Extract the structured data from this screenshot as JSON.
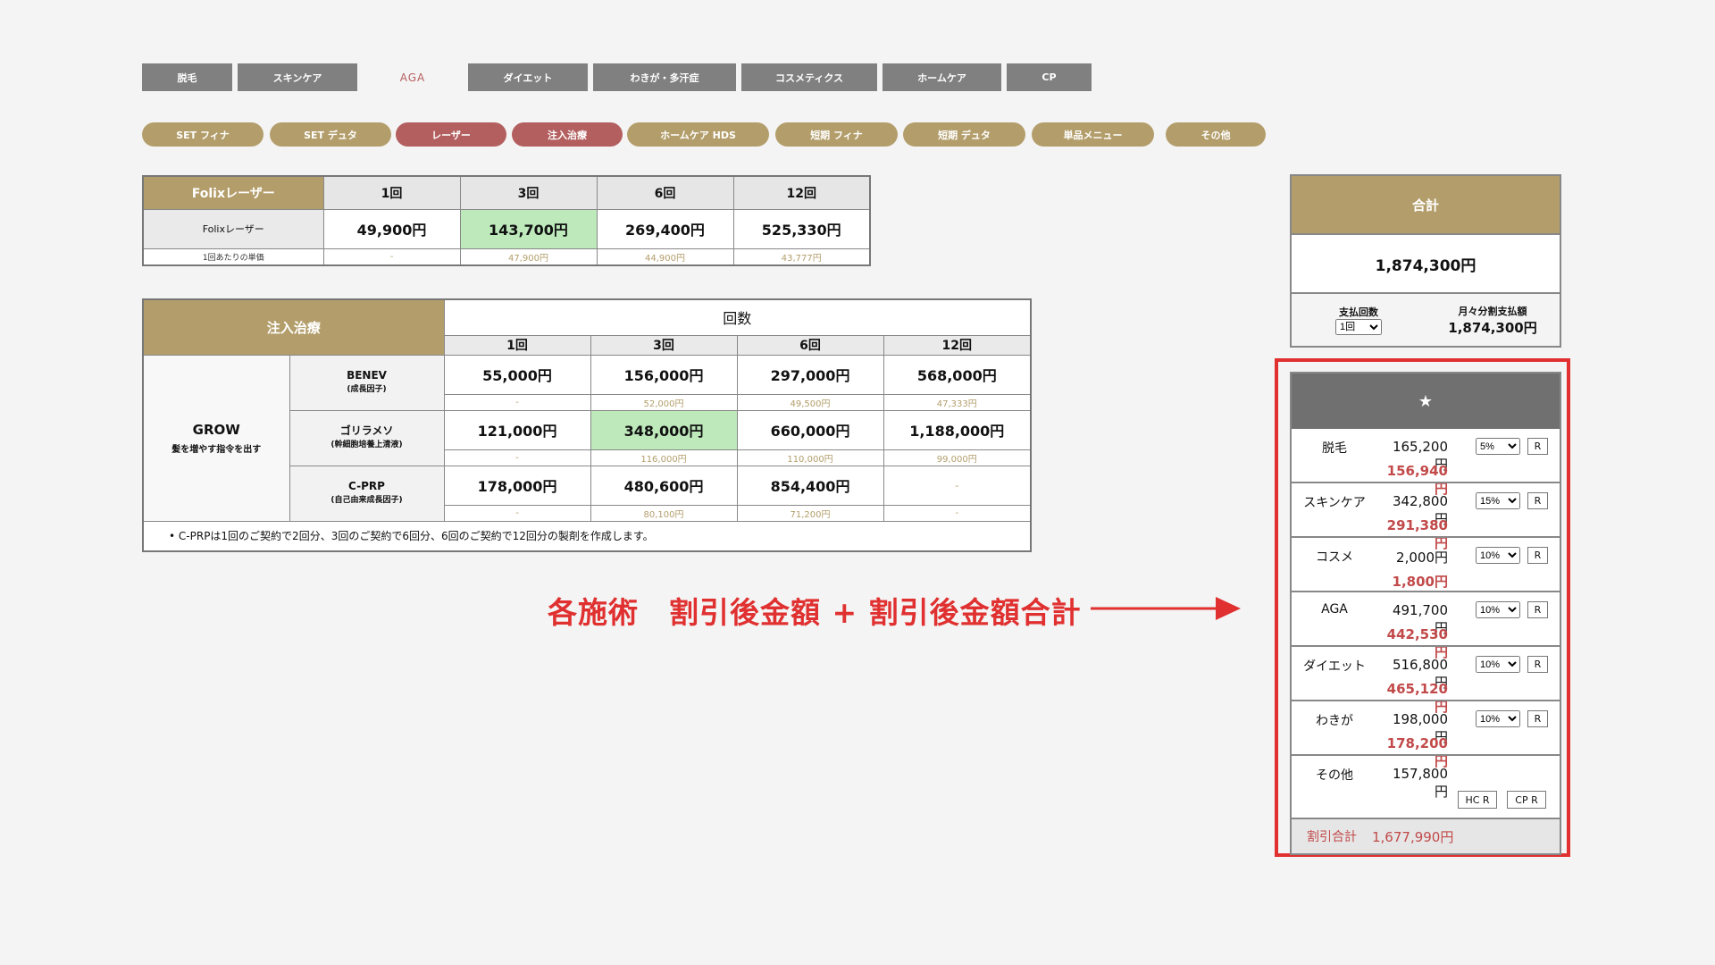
{
  "nav": {
    "tabs": [
      {
        "label": "脱毛",
        "active": false
      },
      {
        "label": "スキンケア",
        "active": false
      },
      {
        "label": "AGA",
        "active": true
      },
      {
        "label": "ダイエット",
        "active": false
      },
      {
        "label": "わきが・多汗症",
        "active": false
      },
      {
        "label": "コスメティクス",
        "active": false
      },
      {
        "label": "ホームケア",
        "active": false
      },
      {
        "label": "CP",
        "active": false
      }
    ],
    "subtabs": [
      {
        "label": "SET フィナ",
        "style": "gold"
      },
      {
        "label": "SET デュタ",
        "style": "gold"
      },
      {
        "label": "レーザー",
        "style": "red"
      },
      {
        "label": "注入治療",
        "style": "red"
      },
      {
        "label": "ホームケア HDS",
        "style": "gold"
      },
      {
        "label": "短期 フィナ",
        "style": "gold"
      },
      {
        "label": "短期 デュタ",
        "style": "gold"
      },
      {
        "label": "単品メニュー",
        "style": "gold"
      },
      {
        "label": "その他",
        "style": "gold"
      }
    ]
  },
  "folix": {
    "header": "Folixレーザー",
    "counts": [
      "1回",
      "3回",
      "6回",
      "12回"
    ],
    "row_label": "Folixレーザー",
    "prices": [
      "49,900円",
      "143,700円",
      "269,400円",
      "525,330円"
    ],
    "unit_label": "1回あたりの単価",
    "unit_prices": [
      "-",
      "47,900円",
      "44,900円",
      "43,777円"
    ],
    "selected_index": 1
  },
  "injection": {
    "header": "注入治療",
    "count_header": "回数",
    "counts": [
      "1回",
      "3回",
      "6回",
      "12回"
    ],
    "group": {
      "name": "GROW",
      "desc": "髪を増やす指令を出す"
    },
    "rows": [
      {
        "name": "BENEV",
        "sub": "(成長因子)",
        "prices": [
          "55,000円",
          "156,000円",
          "297,000円",
          "568,000円"
        ],
        "units": [
          "-",
          "52,000円",
          "49,500円",
          "47,333円"
        ]
      },
      {
        "name": "ゴリラメソ",
        "sub": "(幹細胞培養上清液)",
        "prices": [
          "121,000円",
          "348,000円",
          "660,000円",
          "1,188,000円"
        ],
        "units": [
          "-",
          "116,000円",
          "110,000円",
          "99,000円"
        ]
      },
      {
        "name": "C-PRP",
        "sub": "(自己由来成長因子)",
        "prices": [
          "178,000円",
          "480,600円",
          "854,400円",
          "-"
        ],
        "units": [
          "-",
          "80,100円",
          "71,200円",
          "-"
        ]
      }
    ],
    "note": "C-PRPは1回のご契約で2回分、3回のご契約で6回分、6回のご契約で12回分の製剤を作成します。"
  },
  "annotation": {
    "text": "各施術　割引後金額 + 割引後金額合計",
    "color": "#e03030"
  },
  "total": {
    "header": "合計",
    "value": "1,874,300円",
    "pay_count_label": "支払回数",
    "pay_count_value": "1回",
    "monthly_label": "月々分割支払額",
    "monthly_value": "1,874,300円"
  },
  "discount": {
    "star": "★",
    "rows": [
      {
        "name": "脱毛",
        "price": "165,200円",
        "rate": "5%",
        "reset": "R",
        "after": "156,940円"
      },
      {
        "name": "スキンケア",
        "price": "342,800円",
        "rate": "15%",
        "reset": "R",
        "after": "291,380円"
      },
      {
        "name": "コスメ",
        "price": "2,000円",
        "rate": "10%",
        "reset": "R",
        "after": "1,800円"
      },
      {
        "name": "AGA",
        "price": "491,700円",
        "rate": "10%",
        "reset": "R",
        "after": "442,530円"
      },
      {
        "name": "ダイエット",
        "price": "516,800円",
        "rate": "10%",
        "reset": "R",
        "after": "465,120円"
      },
      {
        "name": "わきが",
        "price": "198,000円",
        "rate": "10%",
        "reset": "R",
        "after": "178,200円"
      }
    ],
    "other": {
      "name": "その他",
      "price": "157,800円",
      "hc_label": "HC R",
      "cp_label": "CP R"
    },
    "total_label": "割引合計",
    "total_value": "1,677,990円"
  },
  "colors": {
    "gold": "#b39e6b",
    "red_tab": "#b45f5f",
    "gray_tab": "#808080",
    "highlight": "#bde9bb",
    "discount_text": "#c24a4a",
    "annotation_red": "#e03030"
  }
}
